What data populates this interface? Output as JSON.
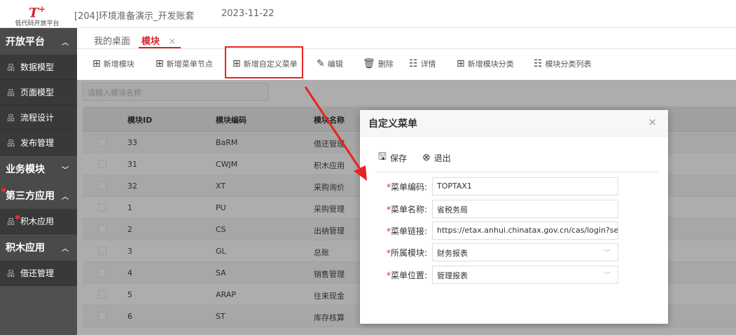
{
  "topbar": {
    "logo_mark": "T",
    "logo_sup": "+",
    "logo_sub": "低代码开放平台",
    "env_title": "[204]环境准备演示_开发账套",
    "date": "2023-11-22"
  },
  "sidebar": {
    "groups": [
      {
        "label": "开放平台",
        "arrow": "^"
      },
      {
        "label": "业务模块",
        "arrow": "v"
      },
      {
        "label": "第三方应用",
        "arrow": "^"
      },
      {
        "label": "积木应用",
        "arrow": "^"
      }
    ],
    "items": [
      {
        "icon": "品",
        "label": "数据模型"
      },
      {
        "icon": "品",
        "label": "页面模型"
      },
      {
        "icon": "品",
        "label": "流程设计"
      },
      {
        "icon": "品",
        "label": "发布管理"
      },
      {
        "icon": "品",
        "label": "积木应用"
      },
      {
        "icon": "品",
        "label": "借还管理"
      }
    ]
  },
  "tabs": {
    "home": "我的桌面",
    "module": "模块",
    "close": "×"
  },
  "toolbar": {
    "add_module": "新增模块",
    "add_menu_node": "新增菜单节点",
    "add_custom_menu": "新增自定义菜单",
    "edit": "编辑",
    "delete": "删除",
    "details": "详情",
    "add_category": "新增模块分类",
    "category_list": "模块分类列表"
  },
  "search": {
    "placeholder": "请输入模块名称"
  },
  "table": {
    "headers": [
      "模块ID",
      "模块编码",
      "模块名称"
    ],
    "rows": [
      [
        "33",
        "BaRM",
        "借还管理"
      ],
      [
        "31",
        "CWJM",
        "积木应用"
      ],
      [
        "32",
        "XT",
        "采购询价"
      ],
      [
        "1",
        "PU",
        "采购管理"
      ],
      [
        "2",
        "CS",
        "出纳管理"
      ],
      [
        "3",
        "GL",
        "总账"
      ],
      [
        "4",
        "SA",
        "销售管理"
      ],
      [
        "5",
        "ARAP",
        "往来现金"
      ],
      [
        "6",
        "ST",
        "库存核算"
      ]
    ]
  },
  "dialog": {
    "title": "自定义菜单",
    "close": "×",
    "save_label": "保存",
    "exit_label": "退出",
    "fields": [
      {
        "label": "菜单编码:",
        "value": ""
      },
      {
        "label": "菜单名称:",
        "value": ""
      },
      {
        "label": "菜单链接:",
        "value": ""
      },
      {
        "label": "所属模块:",
        "value": ""
      },
      {
        "label": "菜单位置:",
        "value": ""
      }
    ],
    "values": {
      "code": "TOPTAX1",
      "name": "省税务局",
      "link": "https://etax.anhui.chinatax.gov.cn/cas/login?service=h",
      "module": "财务报表",
      "position": "管理报表"
    }
  },
  "colors": {
    "accent": "#d9252b",
    "annotation": "#e8231f",
    "sidebar": "#393939"
  }
}
